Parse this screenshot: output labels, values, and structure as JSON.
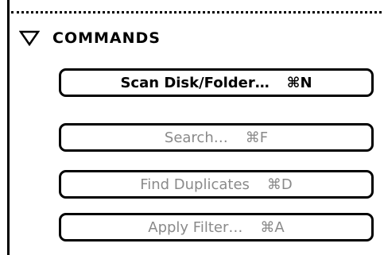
{
  "panel": {
    "section_title": "COMMANDS",
    "disclosure_icon": "triangle-down-outline-icon",
    "buttons": [
      {
        "label": "Scan Disk/Folder…",
        "shortcut": "⌘N",
        "enabled": true
      },
      {
        "label": "Search…",
        "shortcut": "⌘F",
        "enabled": false
      },
      {
        "label": "Find Duplicates",
        "shortcut": "⌘D",
        "enabled": false
      },
      {
        "label": "Apply Filter…",
        "shortcut": "⌘A",
        "enabled": false
      }
    ]
  },
  "colors": {
    "enabled_text": "#000000",
    "disabled_text": "#8a8a8a",
    "border": "#000000",
    "background": "#ffffff"
  }
}
